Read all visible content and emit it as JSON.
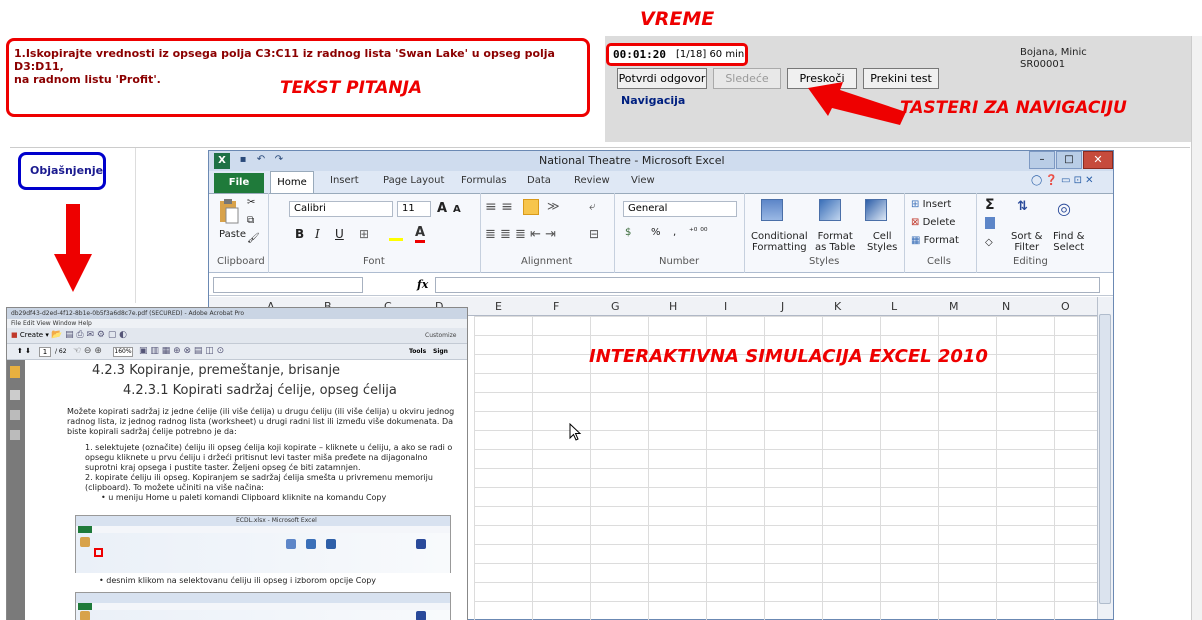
{
  "annotations": {
    "vreme": "VREME",
    "tekst_pitanja": "TEKST PITANJA",
    "tasteri": "TASTERI ZA NAVIGACIJU",
    "simulacija": "INTERAKTIVNA SIMULACIJA EXCEL 2010"
  },
  "question": {
    "line1": "1.Iskopirajte vrednosti iz opsega polja C3:C11 iz radnog lista 'Swan Lake' u opseg polja D3:D11,",
    "line2": "na radnom listu 'Profit'."
  },
  "timer": {
    "time": "00:01:20",
    "counter": "[1/18] 60 min"
  },
  "user": {
    "name": "Bojana, Minic",
    "id": "SR00001"
  },
  "nav": {
    "confirm": "Potvrdi odgovor",
    "next": "Sledeće",
    "skip": "Preskoči",
    "stop": "Prekini test",
    "label": "Navigacija"
  },
  "explanation_label": "Objašnjenje",
  "excel": {
    "title": "National Theatre - Microsoft Excel",
    "file_tab": "File",
    "tabs": [
      "Home",
      "Insert",
      "Page Layout",
      "Formulas",
      "Data",
      "Review",
      "View"
    ],
    "font_name": "Calibri",
    "font_size": "11",
    "number_format": "General",
    "paste": "Paste",
    "bold": "B",
    "italic": "I",
    "underline": "U",
    "percent": "%",
    "comma": ",",
    "sigma": "Σ",
    "font_grow": "A",
    "font_shrink": "A",
    "fx": "fx",
    "ribbon": {
      "conditional": [
        "Conditional",
        "Formatting"
      ],
      "format_table": [
        "Format",
        "as Table"
      ],
      "cell_styles": [
        "Cell",
        "Styles"
      ],
      "insert": "Insert",
      "delete": "Delete",
      "format": "Format",
      "sort": [
        "Sort &",
        "Filter"
      ],
      "find": [
        "Find &",
        "Select"
      ]
    },
    "groups": [
      "Clipboard",
      "Font",
      "Alignment",
      "Number",
      "Styles",
      "Cells",
      "Editing"
    ],
    "columns": [
      "A",
      "B",
      "C",
      "D",
      "E",
      "F",
      "G",
      "H",
      "I",
      "J",
      "K",
      "L",
      "M",
      "N",
      "O"
    ]
  },
  "adobe": {
    "title": "db29df43-d2ed-4f12-8b1e-0b5f3a6d8c7e.pdf (SECURED) - Adobe Acrobat Pro",
    "menu": "File  Edit  View  Window  Help",
    "create": "Create",
    "page_current": "1",
    "page_total": "/ 62",
    "zoom": "160%",
    "customize": "Customize",
    "tools": "Tools",
    "sign": "Sign",
    "heading1": "4.2.3 Kopiranje, premeštanje, brisanje",
    "heading2": "4.2.3.1 Kopirati sadržaj ćelije, opseg ćelija",
    "para": "Možete kopirati sadržaj iz jedne ćelije (ili više ćelija) u drugu ćeliju (ili više ćelija) u okviru jednog radnog lista, iz jednog radnog lista (worksheet) u drugi radni list ili između više dokumenata. Da biste kopirali sadržaj ćelije potrebno je da:",
    "item1": "1.   selektujete (označite) ćeliju ili opseg ćelija koji kopirate – kliknete u ćeliju, a ako se radi o opsegu kliknete u prvu ćeliju i držeći pritisnut levi taster miša pređete na dijagonalno suprotni kraj opsega i pustite taster. Željeni opseg će biti zatamnjen.",
    "item2": "2.   kopirate ćeliju ili opseg. Kopiranjem se sadržaj ćelija smešta u privremenu memoriju (clipboard). To možete učiniti na više načina:",
    "bullet1": "•   u meniju Home u paleti komandi Clipboard kliknite na komandu Copy",
    "bullet2": "•   desnim klikom na selektovanu ćeliju ili opseg i izborom opcije Copy",
    "mini_title": "ECDL.xlsx - Microsoft Excel"
  },
  "colors": {
    "annotation": "#e00000",
    "excel_green": "#1f7a3a",
    "nav_label": "#002080"
  },
  "icons": [
    "excel-logo-icon",
    "save-icon",
    "undo-icon",
    "paste-icon",
    "cut-icon",
    "copy-icon",
    "format-painter-icon",
    "fill-color-icon",
    "font-color-icon",
    "mouse-cursor-icon",
    "help-icon"
  ]
}
